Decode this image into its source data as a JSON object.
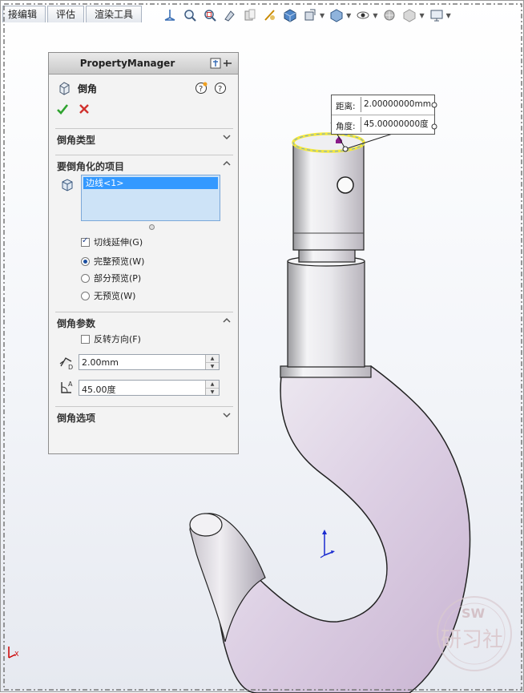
{
  "toolbar": {
    "tabs": [
      "接编辑",
      "评估",
      "渲染工具"
    ],
    "icons": [
      "view-orientation-icon",
      "zoom-to-fit-icon",
      "zoom-to-area-icon",
      "previous-view-icon",
      "section-view-icon",
      "dynamic-annotation-icon",
      "view-orientation-cube-icon",
      "display-style-icon",
      "hide-show-icon",
      "edit-appearance-icon",
      "apply-scene-icon",
      "view-settings-icon",
      "display-icon"
    ]
  },
  "property_manager": {
    "header": "PropertyManager",
    "feature_name": "倒角",
    "sections": {
      "chamfer_type": "倒角类型",
      "items_to_chamfer": "要倒角化的项目",
      "chamfer_params": "倒角参数",
      "chamfer_options": "倒角选项"
    },
    "selected_items": [
      "边线<1>"
    ],
    "options": {
      "tangent_propagation": {
        "label": "切线延伸(G)",
        "checked": true
      },
      "preview_full": {
        "label": "完整预览(W)",
        "selected": true
      },
      "preview_partial": {
        "label": "部分预览(P)",
        "selected": false
      },
      "preview_none": {
        "label": "无预览(W)",
        "selected": false
      },
      "reverse_direction": {
        "label": "反转方向(F)",
        "checked": false
      }
    },
    "distance_value": "2.00mm",
    "angle_value": "45.00度"
  },
  "callout": {
    "distance_label": "距离:",
    "distance_value": "2.00000000mm",
    "angle_label": "角度:",
    "angle_value": "45.00000000度"
  },
  "colors": {
    "selection_highlight": "#3399ff",
    "list_background": "#cde3f7",
    "accept_green": "#2fa32f",
    "cancel_red": "#d0312d",
    "edge_preview_yellow": "#f4e83a",
    "hook_tint": "#d8c8df"
  }
}
